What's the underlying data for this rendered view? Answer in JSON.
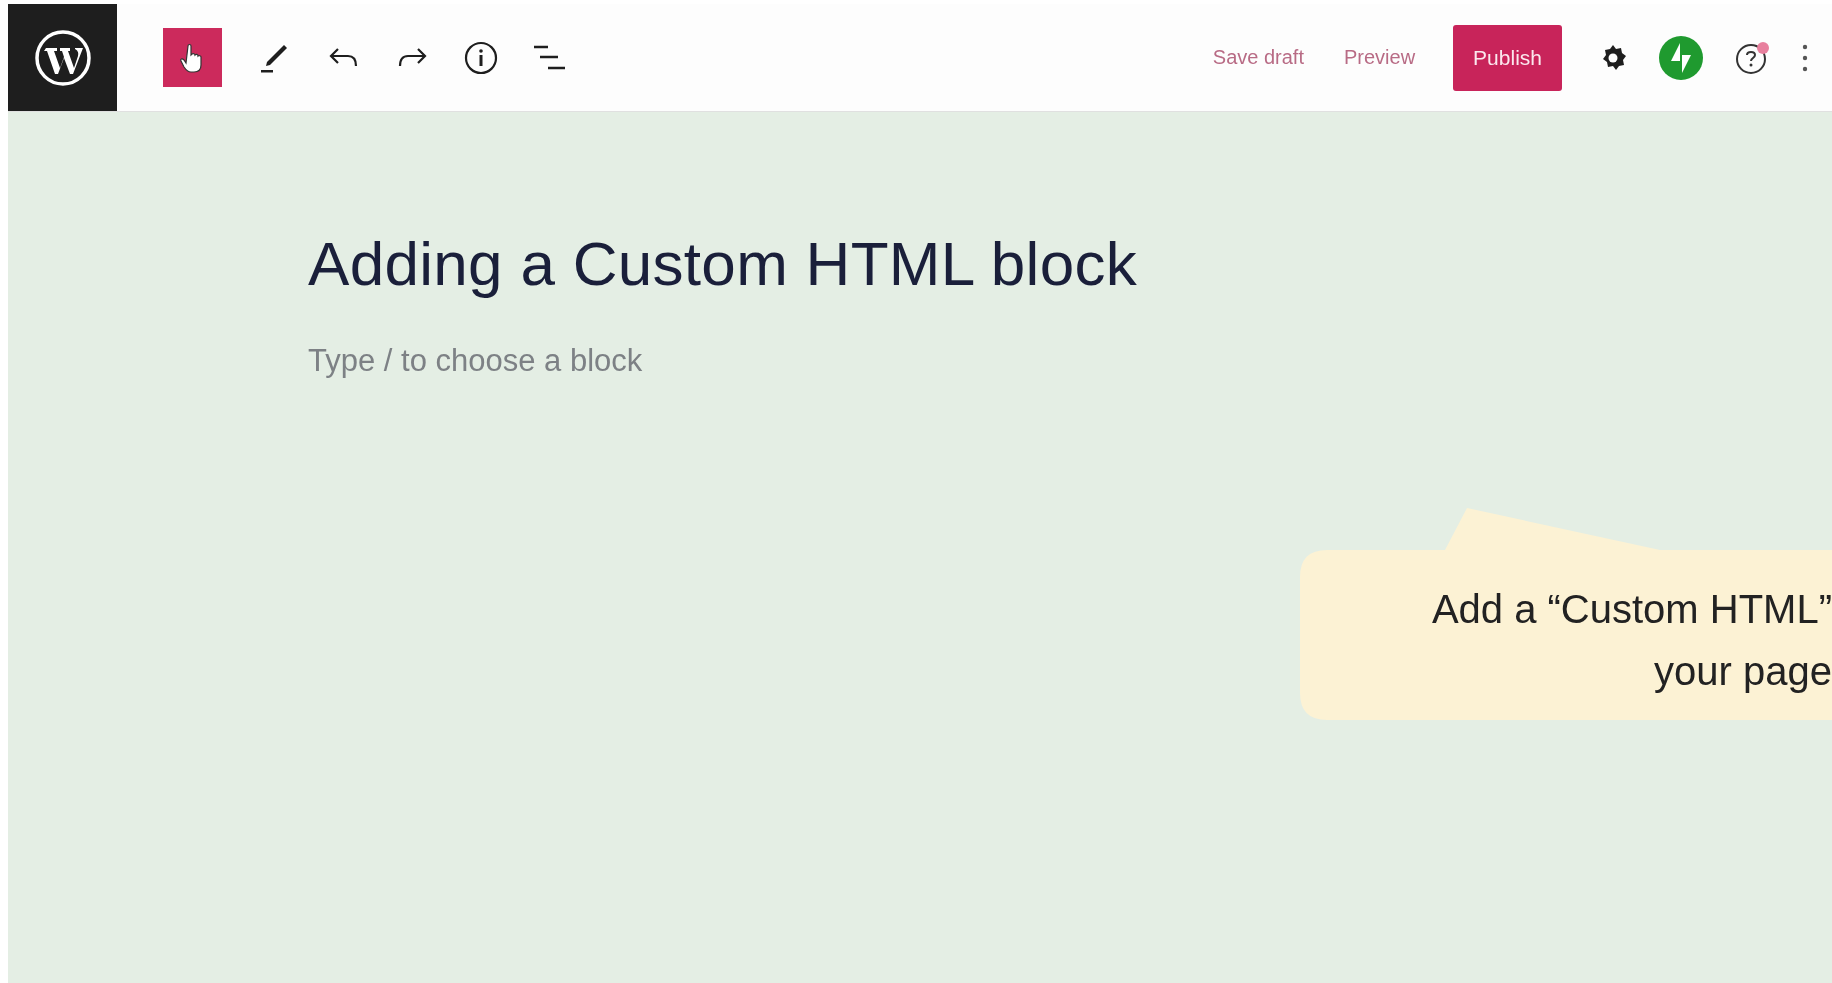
{
  "toolbar": {
    "actions": [
      {
        "label": "Save draft",
        "kind": "link"
      },
      {
        "label": "Preview",
        "kind": "link"
      },
      {
        "label": "Publish",
        "kind": "primary"
      }
    ]
  },
  "editor": {
    "title": "Adding a Custom HTML block",
    "block": {
      "placeholder": "Type / to choose a block"
    }
  },
  "callout": {
    "lines": [
      "Add a “Custom HTML”",
      "your page"
    ]
  }
}
